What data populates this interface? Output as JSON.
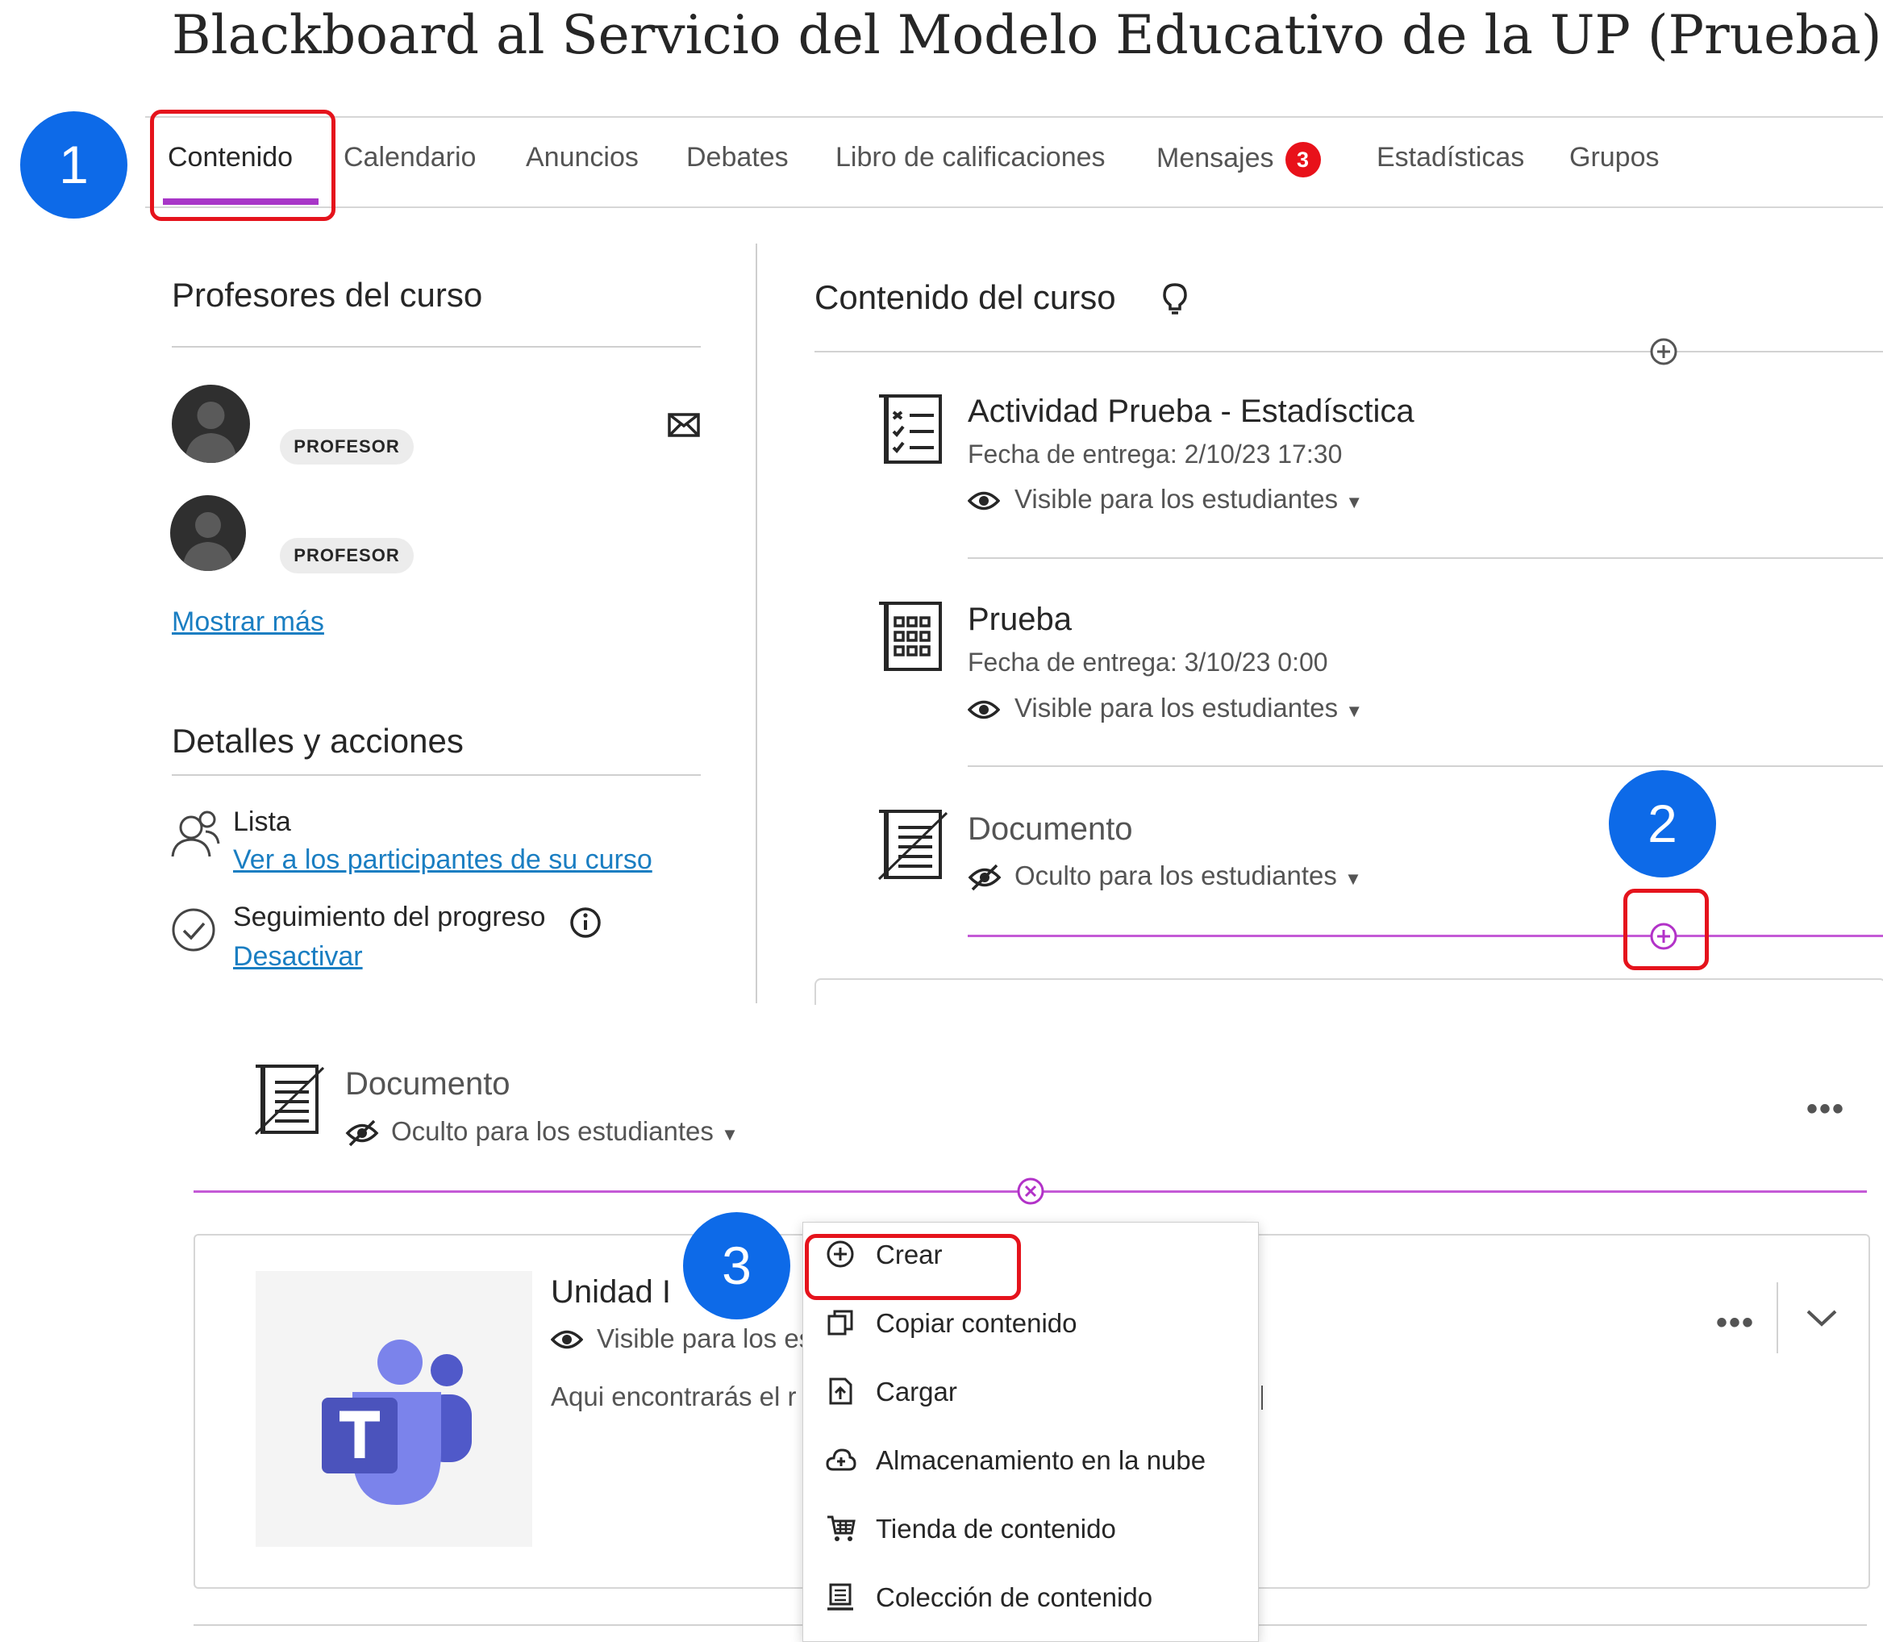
{
  "course": {
    "title": "Blackboard al Servicio del Modelo Educativo de la UP (Prueba)"
  },
  "tabs": [
    {
      "label": "Contenido"
    },
    {
      "label": "Calendario"
    },
    {
      "label": "Anuncios"
    },
    {
      "label": "Debates"
    },
    {
      "label": "Libro de calificaciones"
    },
    {
      "label": "Mensajes",
      "badge": "3"
    },
    {
      "label": "Estadísticas"
    },
    {
      "label": "Grupos"
    }
  ],
  "markers": {
    "one": "1",
    "two": "2",
    "three": "3"
  },
  "sidebar": {
    "instructors_title": "Profesores del curso",
    "instructors": [
      {
        "role": "PROFESOR"
      },
      {
        "role": "PROFESOR"
      }
    ],
    "show_more": "Mostrar más",
    "details_title": "Detalles y acciones",
    "roster_label": "Lista",
    "roster_link": "Ver a los participantes de su curso",
    "progress_label": "Seguimiento del progreso",
    "progress_link": "Desactivar"
  },
  "content": {
    "title": "Contenido del curso",
    "items": [
      {
        "title": "Actividad Prueba - Estadísctica",
        "due": "Fecha de entrega: 2/10/23 17:30",
        "visibility": "Visible para los estudiantes"
      },
      {
        "title": "Prueba",
        "due": "Fecha de entrega: 3/10/23 0:00",
        "visibility": "Visible para los estudiantes"
      },
      {
        "title": "Documento",
        "visibility": "Oculto para los estudiantes"
      }
    ]
  },
  "zoom": {
    "document": {
      "title": "Documento",
      "visibility": "Oculto para los estudiantes"
    },
    "unit": {
      "title": "Unidad I",
      "visibility": "Visible para los es",
      "description": "Aqui encontrarás el r"
    },
    "menu": [
      {
        "label": "Crear",
        "icon": "plus-circle-icon"
      },
      {
        "label": "Copiar contenido",
        "icon": "copy-icon"
      },
      {
        "label": "Cargar",
        "icon": "upload-icon"
      },
      {
        "label": "Almacenamiento en la nube",
        "icon": "cloud-icon"
      },
      {
        "label": "Tienda de contenido",
        "icon": "store-icon"
      },
      {
        "label": "Colección de contenido",
        "icon": "collection-icon"
      }
    ]
  },
  "colors": {
    "accent": "#a836c8",
    "highlight": "#e5131c",
    "marker": "#0d6ae8",
    "link": "#1a7ec2"
  }
}
